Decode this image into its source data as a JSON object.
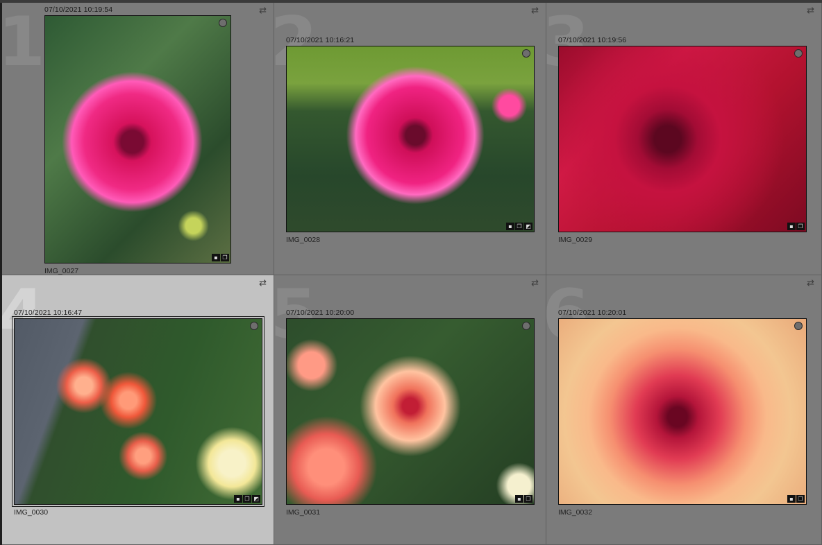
{
  "grid": {
    "cells": [
      {
        "index": "1",
        "timestamp": "07/10/2021 10:19:54",
        "filename": "IMG_0027",
        "selected": false,
        "rotate_icon": "rotate-arrows-icon",
        "badges": [
          "comment",
          "stack"
        ]
      },
      {
        "index": "2",
        "timestamp": "07/10/2021 10:16:21",
        "filename": "IMG_0028",
        "selected": false,
        "rotate_icon": "rotate-arrows-icon",
        "badges": [
          "comment",
          "stack",
          "edited"
        ]
      },
      {
        "index": "3",
        "timestamp": "07/10/2021 10:19:56",
        "filename": "IMG_0029",
        "selected": false,
        "rotate_icon": "rotate-arrows-icon",
        "badges": [
          "comment",
          "stack"
        ]
      },
      {
        "index": "4",
        "timestamp": "07/10/2021 10:16:47",
        "filename": "IMG_0030",
        "selected": true,
        "rotate_icon": "rotate-arrows-icon",
        "badges": [
          "comment",
          "stack",
          "edited"
        ]
      },
      {
        "index": "5",
        "timestamp": "07/10/2021 10:20:00",
        "filename": "IMG_0031",
        "selected": false,
        "rotate_icon": "rotate-arrows-icon",
        "badges": [
          "comment",
          "stack"
        ]
      },
      {
        "index": "6",
        "timestamp": "07/10/2021 10:20:01",
        "filename": "IMG_0032",
        "selected": false,
        "rotate_icon": "rotate-arrows-icon",
        "badges": [
          "comment",
          "stack"
        ]
      }
    ]
  },
  "glyphs": {
    "rotate": "⇄",
    "comment": "▪",
    "stack": "❐",
    "edited": "◩"
  },
  "colors": {
    "cell_bg": "#7b7b7b",
    "cell_selected_bg": "#c2c2c2",
    "divider": "#5f5f5f"
  }
}
